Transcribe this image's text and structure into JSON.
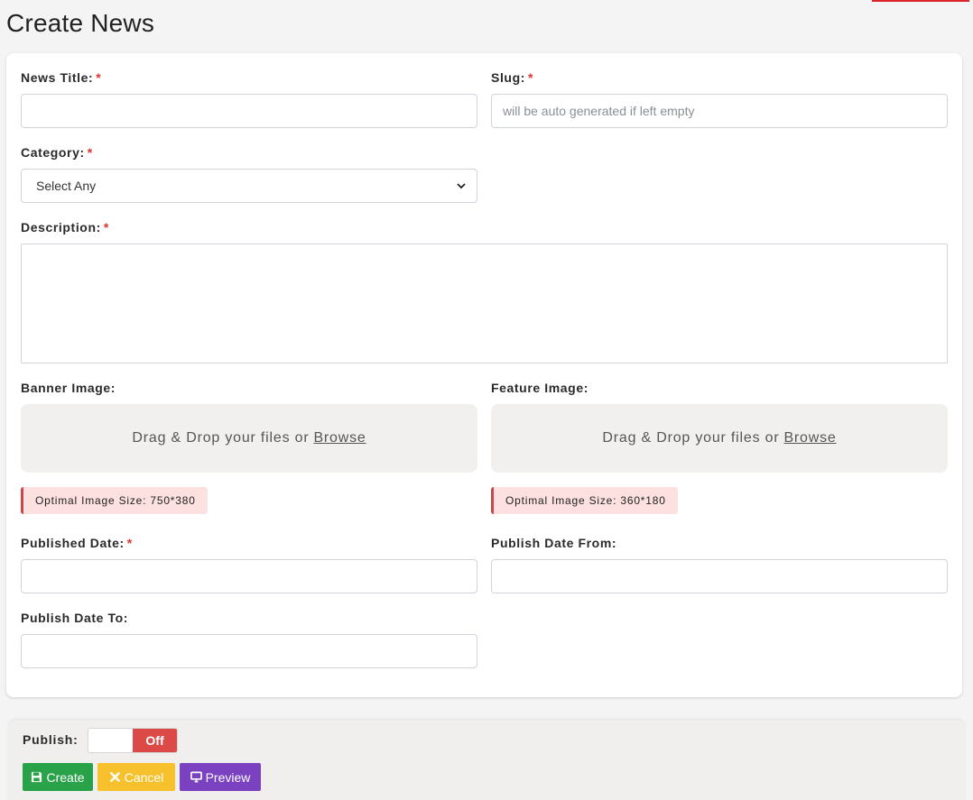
{
  "page": {
    "title": "Create News"
  },
  "form": {
    "news_title": {
      "label": "News Title:",
      "value": "",
      "placeholder": ""
    },
    "slug": {
      "label": "Slug:",
      "value": "",
      "placeholder": "will be auto generated if left empty"
    },
    "category": {
      "label": "Category:",
      "selected": "Select Any"
    },
    "description": {
      "label": "Description:",
      "value": ""
    },
    "banner_image": {
      "label": "Banner Image:",
      "drop_text": "Drag & Drop your files or",
      "browse": "Browse",
      "hint": "Optimal Image Size: 750*380"
    },
    "feature_image": {
      "label": "Feature Image:",
      "drop_text": "Drag & Drop your files or",
      "browse": "Browse",
      "hint": "Optimal Image Size: 360*180"
    },
    "published_date": {
      "label": "Published Date:",
      "value": ""
    },
    "publish_date_from": {
      "label": "Publish Date From:",
      "value": ""
    },
    "publish_date_to": {
      "label": "Publish Date To:",
      "value": ""
    },
    "required_mark": "*"
  },
  "footer": {
    "publish_label": "Publish:",
    "toggle_state": "Off",
    "buttons": {
      "create": "Create",
      "cancel": "Cancel",
      "preview": "Preview"
    }
  },
  "colors": {
    "accent_red": "#d9242a",
    "create": "#2aa24a",
    "cancel": "#f7c12d",
    "preview": "#7a42c0",
    "toggle_off": "#dc4a48",
    "hint_bg": "#fde1e1"
  },
  "icons": {
    "create": "floppy-disk-icon",
    "cancel": "x-mark-icon",
    "preview": "monitor-icon",
    "category": "chevron-down-icon"
  }
}
